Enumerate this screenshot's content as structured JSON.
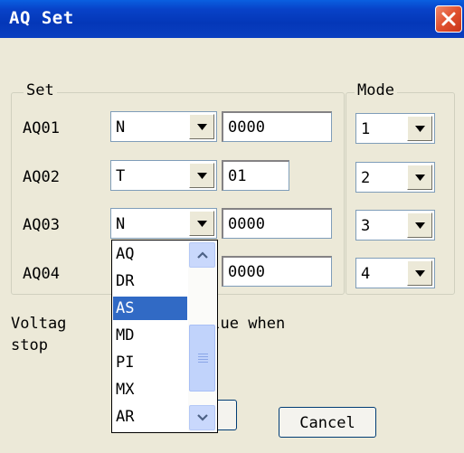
{
  "window": {
    "title": "AQ Set",
    "close_icon": "close-x-icon"
  },
  "set_group": {
    "legend": "Set",
    "rows": [
      {
        "label": "AQ01",
        "type": "N",
        "value": "0000"
      },
      {
        "label": "AQ02",
        "type": "T",
        "value": "01"
      },
      {
        "label": "AQ03",
        "type": "N",
        "value": "0000"
      },
      {
        "label": "AQ04",
        "type": "",
        "value": "0000"
      }
    ]
  },
  "mode_group": {
    "legend": "Mode",
    "values": [
      "1",
      "2",
      "3",
      "4"
    ]
  },
  "note": {
    "line1": "Voltage output preset value when",
    "line2": "stop",
    "visible_part1": "Voltag",
    "visible_part2": "reset value when"
  },
  "buttons": {
    "cancel": "Cancel"
  },
  "dropdown": {
    "options": [
      "AQ",
      "DR",
      "AS",
      "MD",
      "PI",
      "MX",
      "AR"
    ],
    "selected": "AS",
    "icons": {
      "up": "scroll-up-arrow-icon",
      "down": "scroll-down-arrow-icon"
    }
  },
  "colors": {
    "titlebar": "#0437b8",
    "selection": "#316ac5",
    "close": "#e0502e"
  }
}
